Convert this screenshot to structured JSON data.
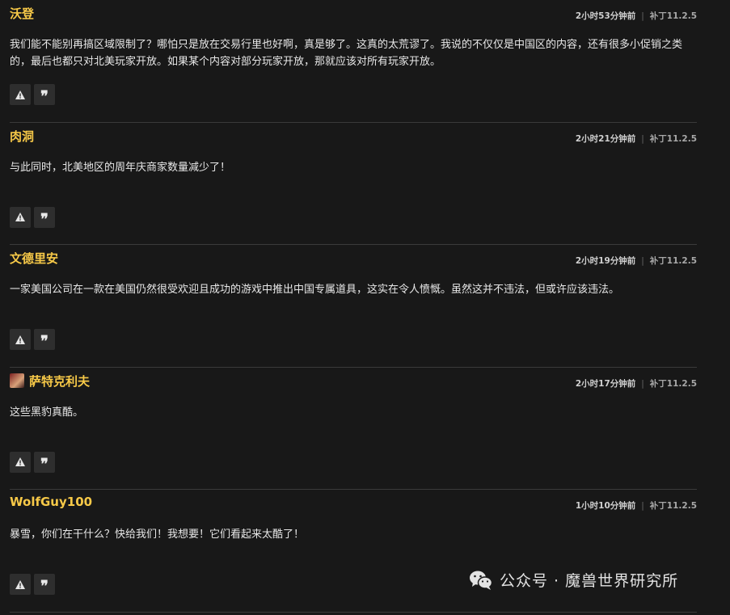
{
  "comments": [
    {
      "author": "沃登",
      "time": "2小时53分钟前",
      "patch": "补丁11.2.5",
      "text": "我们能不能别再搞区域限制了？哪怕只是放在交易行里也好啊，真是够了。这真的太荒谬了。我说的不仅仅是中国区的内容，还有很多小促销之类的，最后也都只对北美玩家开放。如果某个内容对部分玩家开放，那就应该对所有玩家开放。"
    },
    {
      "author": "肉洞",
      "time": "2小时21分钟前",
      "patch": "补丁11.2.5",
      "text": "与此同时，北美地区的周年庆商家数量减少了！"
    },
    {
      "author": "文德里安",
      "time": "2小时19分钟前",
      "patch": "补丁11.2.5",
      "text": "一家美国公司在一款在美国仍然很受欢迎且成功的游戏中推出中国专属道具，这实在令人愤慨。虽然这并不违法，但或许应该违法。"
    },
    {
      "author": "萨特克利夫",
      "time": "2小时17分钟前",
      "patch": "补丁11.2.5",
      "text": "这些黑豹真酷。"
    },
    {
      "author": "WolfGuy100",
      "time": "1小时10分钟前",
      "patch": "补丁11.2.5",
      "text": "暴雪，你们在干什么？快给我们！我想要！它们看起来太酷了！"
    }
  ],
  "watermark": {
    "text": "公众号 · 魔兽世界研究所"
  },
  "icons": {
    "report": "warning-triangle-icon",
    "quote": "quote-icon",
    "watermark": "wechat-icon"
  },
  "colors": {
    "background": "#181818",
    "author": "#f7c948",
    "divider": "#3a3a3a",
    "button": "#2e2e2e"
  }
}
